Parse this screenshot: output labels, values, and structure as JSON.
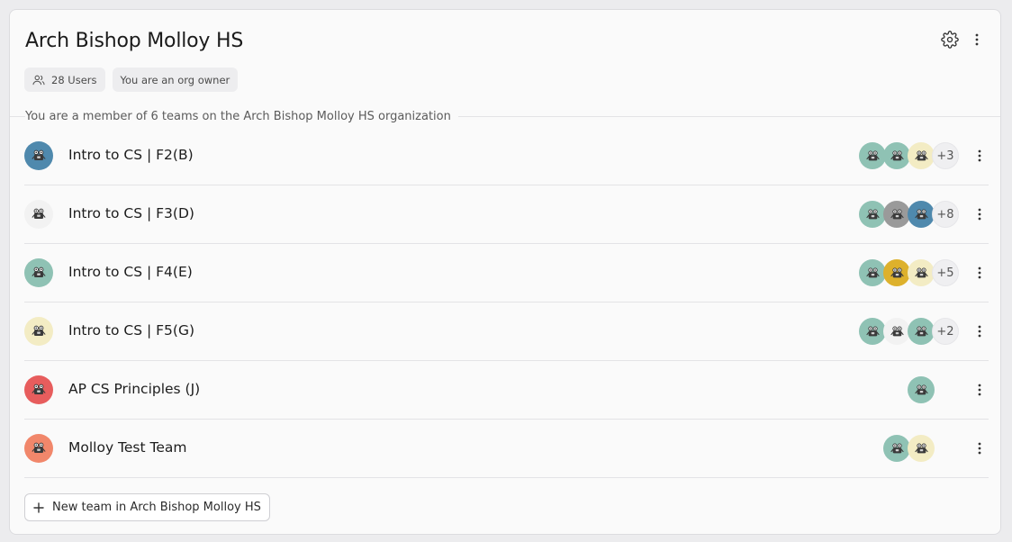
{
  "org": {
    "title": "Arch Bishop Molloy HS",
    "users_chip": "28 Users",
    "role_chip": "You are an org owner",
    "member_note": "You are a member of 6 teams on the Arch Bishop Molloy HS organization"
  },
  "icons": {
    "settings": "gear-icon",
    "menu": "kebab-menu-icon",
    "users": "users-icon",
    "avatar": "robot-avatar-icon",
    "add": "plus-icon"
  },
  "colors": {
    "teal": "#8fc2b4",
    "blue": "#4f89ad",
    "white": "#f2f2f2",
    "cream": "#f3ecc4",
    "red": "#e75d5d",
    "coral": "#f1876b",
    "gray": "#9a9a9a",
    "mustard": "#ddb12c"
  },
  "teams": [
    {
      "name": "Intro to CS | F2(B)",
      "avatar_color": "#4f89ad",
      "members": [
        "#8fc2b4",
        "#8fc2b4",
        "#f3ecc4"
      ],
      "more": "+3"
    },
    {
      "name": "Intro to CS | F3(D)",
      "avatar_color": "#f2f2f2",
      "members": [
        "#8fc2b4",
        "#9a9a9a",
        "#4f89ad"
      ],
      "more": "+8"
    },
    {
      "name": "Intro to CS | F4(E)",
      "avatar_color": "#8fc2b4",
      "members": [
        "#8fc2b4",
        "#ddb12c",
        "#f3ecc4"
      ],
      "more": "+5"
    },
    {
      "name": "Intro to CS | F5(G)",
      "avatar_color": "#f3ecc4",
      "members": [
        "#8fc2b4",
        "#f2f2f2",
        "#8fc2b4"
      ],
      "more": "+2"
    },
    {
      "name": "AP CS Principles (J)",
      "avatar_color": "#e75d5d",
      "members": [
        "#8fc2b4"
      ],
      "more": ""
    },
    {
      "name": "Molloy Test Team",
      "avatar_color": "#f1876b",
      "members": [
        "#8fc2b4",
        "#f3ecc4"
      ],
      "more": ""
    }
  ],
  "new_team_label": "New team in Arch Bishop Molloy HS"
}
